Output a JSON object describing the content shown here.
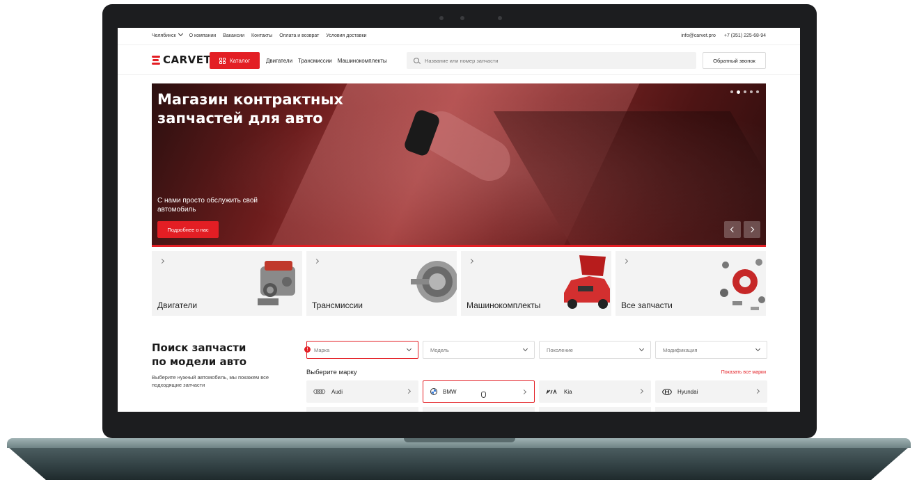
{
  "topbar": {
    "city": "Челябинск",
    "links": [
      "О компании",
      "Вакансии",
      "Контакты",
      "Оплата и возврат",
      "Условия доставки"
    ],
    "email": "info@carvet.pro",
    "phone": "+7 (351) 225-68-94"
  },
  "header": {
    "logo": "CARVET",
    "catalog_label": "Каталог",
    "nav": [
      "Двигатели",
      "Трансмиссии",
      "Машинокомплекты"
    ],
    "search_placeholder": "Название или номер запчасти",
    "callback_label": "Обратный звонок"
  },
  "hero": {
    "title": "Магазин контрактных запчастей для авто",
    "subtitle": "С нами просто обслужить свой автомобиль",
    "button_label": "Подробнее о нас",
    "slide_count": 5,
    "active_slide": 1
  },
  "categories": [
    {
      "label": "Двигатели"
    },
    {
      "label": "Трансмиссии"
    },
    {
      "label": "Машинокомплекты"
    },
    {
      "label": "Все запчасти"
    }
  ],
  "model_search": {
    "title": "Поиск запчасти по модели авто",
    "description": "Выберите нужный автомобиль, мы покажем все подходящие запчасти",
    "badge": "!",
    "selects": [
      {
        "placeholder": "Марка"
      },
      {
        "placeholder": "Модель"
      },
      {
        "placeholder": "Поколение"
      },
      {
        "placeholder": "Модификация"
      }
    ],
    "choose_label": "Выберите марку",
    "show_all": "Показать все марки",
    "brands": [
      {
        "name": "Audi",
        "logo": "audi-rings"
      },
      {
        "name": "BMW",
        "logo": "bmw-roundel"
      },
      {
        "name": "Kia",
        "logo": "kia-wordmark"
      },
      {
        "name": "Hyundai",
        "logo": "hyundai-h"
      }
    ]
  },
  "colors": {
    "accent": "#e31e24",
    "card_bg": "#f3f3f3",
    "frame": "#1c1d1f"
  }
}
